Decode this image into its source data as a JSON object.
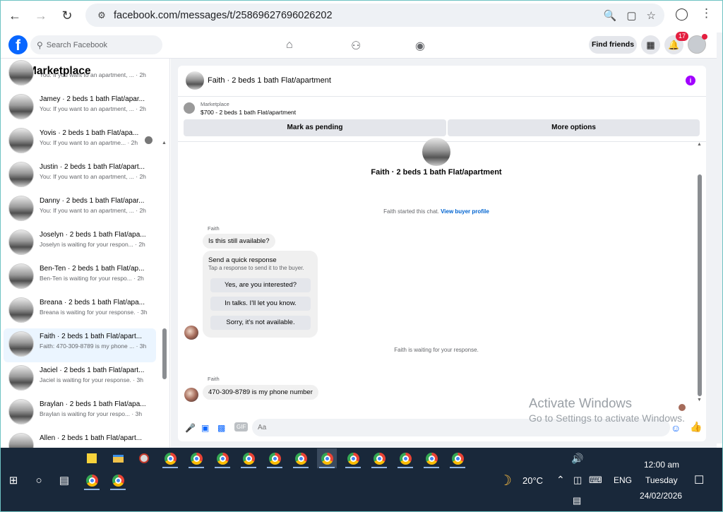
{
  "browser": {
    "url": "facebook.com/messages/t/25869627696026202"
  },
  "fb_header": {
    "search_placeholder": "Search Facebook",
    "find_friends": "Find friends",
    "notifications_count": "17"
  },
  "sidebar": {
    "title": "Marketplace",
    "conversations": [
      {
        "title": "",
        "subtitle": "You: If you want to an apartment, ...",
        "time": "· 2h"
      },
      {
        "title": "Jamey · 2 beds 1 bath Flat/apar...",
        "subtitle": "You: If you want to an apartment, ...",
        "time": "· 2h"
      },
      {
        "title": "Yovis · 2 beds 1 bath Flat/apa...",
        "subtitle": "You: If you want to an apartme...",
        "time": "· 2h"
      },
      {
        "title": "Justin · 2 beds 1 bath Flat/apart...",
        "subtitle": "You: If you want to an apartment, ...",
        "time": "· 2h"
      },
      {
        "title": "Danny · 2 beds 1 bath Flat/apar...",
        "subtitle": "You: If you want to an apartment, ...",
        "time": "· 2h"
      },
      {
        "title": "Joselyn · 2 beds 1 bath Flat/apa...",
        "subtitle": "Joselyn is waiting for your respon...",
        "time": "· 2h"
      },
      {
        "title": "Ben-Ten · 2 beds 1 bath Flat/ap...",
        "subtitle": "Ben-Ten is waiting for your respo...",
        "time": "· 2h"
      },
      {
        "title": "Breana · 2 beds 1 bath Flat/apa...",
        "subtitle": "Breana is waiting for your response.",
        "time": "· 3h"
      },
      {
        "title": "Faith · 2 beds 1 bath Flat/apart...",
        "subtitle": "Faith: 470-309-8789 is my phone ...",
        "time": "· 3h"
      },
      {
        "title": "Jaciel · 2 beds 1 bath Flat/apart...",
        "subtitle": "Jaciel is waiting for your response.",
        "time": "· 3h"
      },
      {
        "title": "Braylan · 2 beds 1 bath Flat/apa...",
        "subtitle": "Braylan is waiting for your respo...",
        "time": "· 3h"
      },
      {
        "title": "Allen · 2 beds 1 bath Flat/apart...",
        "subtitle": "",
        "time": ""
      }
    ]
  },
  "chat": {
    "header_title": "Faith · 2 beds 1 bath Flat/apartment",
    "marketplace_label": "Marketplace",
    "listing": "$700 - 2 beds 1 bath Flat/apartment",
    "mark_pending": "Mark as pending",
    "more_options": "More options",
    "top_title": "Faith · 2 beds 1 bath Flat/apartment",
    "started_text": "Faith started this chat.",
    "view_profile": "View buyer profile",
    "sender_name": "Faith",
    "message_1": "Is this still available?",
    "quick_title": "Send a quick response",
    "quick_sub": "Tap a response to send it to the buyer.",
    "quick_responses": [
      "Yes, are you interested?",
      "In talks. I'll let you know.",
      "Sorry, it's not available."
    ],
    "waiting_text": "Faith is waiting for your response.",
    "sender_name_2": "Faith",
    "message_2": "470-309-8789 is my phone number",
    "compose_placeholder": "Aa",
    "gif_label": "GIF"
  },
  "watermark": {
    "line1": "Activate Windows",
    "line2": "Go to Settings to activate Windows."
  },
  "taskbar": {
    "weather": "20°C",
    "lang": "ENG",
    "time": "12:00 am",
    "day": "Tuesday",
    "date": "24/02/2026"
  }
}
